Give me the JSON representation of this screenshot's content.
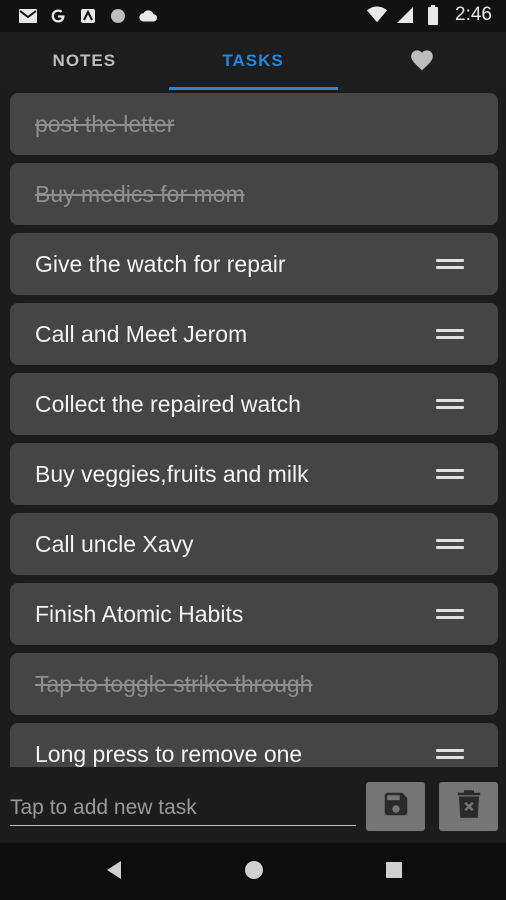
{
  "status_bar": {
    "time": "2:46",
    "left_icons": [
      "gmail-icon",
      "google-icon",
      "app-icon",
      "circle-icon",
      "cloud-icon"
    ],
    "right_icons": [
      "wifi-icon",
      "signal-icon",
      "battery-icon"
    ]
  },
  "tabs": [
    {
      "label": "NOTES",
      "active": false
    },
    {
      "label": "TASKS",
      "active": true
    },
    {
      "label": "",
      "icon": "heart-icon",
      "active": false
    }
  ],
  "tasks": [
    {
      "text": "post the letter",
      "done": true
    },
    {
      "text": "Buy medics for mom",
      "done": true
    },
    {
      "text": "Give the watch for repair",
      "done": false
    },
    {
      "text": "Call and Meet Jerom",
      "done": false
    },
    {
      "text": "Collect the repaired watch",
      "done": false
    },
    {
      "text": "Buy veggies,fruits and milk",
      "done": false
    },
    {
      "text": "Call uncle Xavy",
      "done": false
    },
    {
      "text": "Finish Atomic Habits",
      "done": false
    },
    {
      "text": "Tap to toggle strike through",
      "done": true
    },
    {
      "text": "Long press to remove one",
      "done": false
    }
  ],
  "input": {
    "placeholder": "Tap to add new task",
    "value": ""
  },
  "buttons": {
    "save_icon": "save-icon",
    "clear_icon": "delete-icon"
  },
  "colors": {
    "accent": "#1e88e5",
    "card": "#454545",
    "background": "#1c1c1c"
  }
}
